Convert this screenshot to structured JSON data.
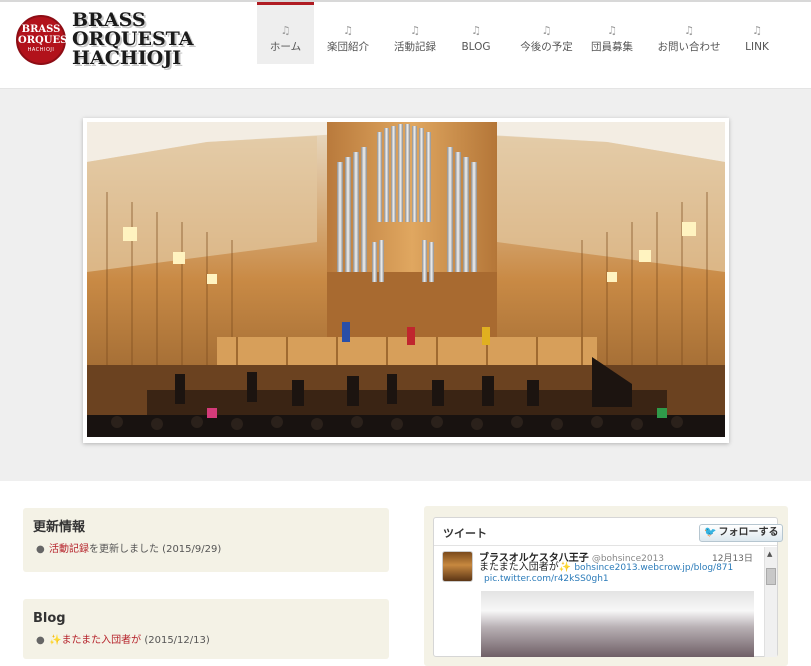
{
  "logo": {
    "emblem_line1": "BRASS",
    "emblem_line2": "ORQUESTA",
    "emblem_line3": "HACHIOJI",
    "line1": "BRASS",
    "line2": "ORQUESTA",
    "line3": "HACHIOJI",
    "brand_color": "#b2121b"
  },
  "nav": {
    "note_icon": "♫",
    "active_color": "#b01c23",
    "items": [
      {
        "label": "ホーム",
        "active": true
      },
      {
        "label": "楽団紹介"
      },
      {
        "label": "活動記録"
      },
      {
        "label": "BLOG"
      },
      {
        "label": "今後の予定"
      },
      {
        "label": "団員募集"
      },
      {
        "label": "お問い合わせ"
      },
      {
        "label": "LINK"
      }
    ]
  },
  "updates": {
    "title": "更新情報",
    "items": [
      {
        "link": "活動記録",
        "text": "を更新しました (2015/9/29)"
      }
    ]
  },
  "blog": {
    "title": "Blog",
    "items": [
      {
        "icon": "sparkle-icon",
        "link": "またまた入団者が",
        "text": " (2015/12/13)"
      }
    ]
  },
  "twitter": {
    "title": "ツイート",
    "follow_label": "フォローする",
    "tweet": {
      "name": "ブラスオルケスタ八王子",
      "handle": "@bohsince2013",
      "date": "12月13日",
      "text": "またまた入団者が",
      "link": "bohsince2013.webcrow.jp/blog/871",
      "pic_link": "pic.twitter.com/r42kSS0gh1"
    }
  }
}
